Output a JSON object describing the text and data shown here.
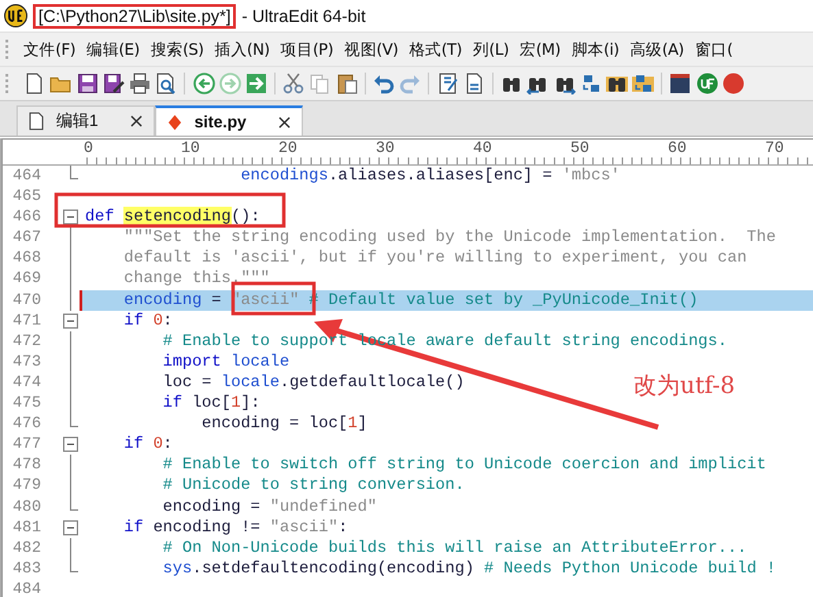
{
  "window": {
    "title_path": "[C:\\Python27\\Lib\\site.py*]",
    "title_app": "- UltraEdit 64-bit"
  },
  "menu": [
    "文件(F)",
    "编辑(E)",
    "搜索(S)",
    "插入(N)",
    "项目(P)",
    "视图(V)",
    "格式(T)",
    "列(L)",
    "宏(M)",
    "脚本(i)",
    "高级(A)",
    "窗口("
  ],
  "tabs": [
    {
      "label": "编辑1",
      "kind": "blank",
      "selected": false
    },
    {
      "label": "site.py",
      "kind": "source",
      "selected": true
    }
  ],
  "ruler": {
    "labels": [
      "0",
      "10",
      "20",
      "30",
      "40",
      "50",
      "60",
      "70"
    ]
  },
  "lines": [
    {
      "number": "464",
      "kind": "end",
      "highlighted": false,
      "tokens": [
        {
          "kind": "mod",
          "text": "                encodings"
        },
        {
          "kind": "plain",
          "text": ".aliases.aliases[enc] = "
        },
        {
          "kind": "str",
          "text": "'mbcs'"
        }
      ]
    },
    {
      "number": "465",
      "kind": "plain",
      "highlighted": false
    },
    {
      "number": "466",
      "kind": "start",
      "highlighted": false,
      "tokens": [
        {
          "kind": "kw",
          "text": "def "
        },
        {
          "kind": "hl",
          "text": "setencoding"
        },
        {
          "kind": "plain",
          "text": "():"
        }
      ]
    },
    {
      "number": "467",
      "kind": "body",
      "highlighted": false,
      "tokens": [
        {
          "kind": "str",
          "text": "    \"\"\"Set the string encoding used by the Unicode implementation.  The"
        }
      ]
    },
    {
      "number": "468",
      "kind": "body",
      "highlighted": false,
      "tokens": [
        {
          "kind": "str",
          "text": "    default is 'ascii', but if you're willing to experiment, you can"
        }
      ]
    },
    {
      "number": "469",
      "kind": "body",
      "highlighted": false,
      "tokens": [
        {
          "kind": "str",
          "text": "    change this.\"\"\""
        }
      ]
    },
    {
      "number": "470",
      "kind": "body",
      "highlighted": true,
      "tokens": [
        {
          "kind": "mod",
          "text": "    encoding"
        },
        {
          "kind": "plain",
          "text": " = "
        },
        {
          "kind": "str",
          "text": "\"ascii\""
        },
        {
          "kind": "com",
          "text": " # Default value set by _PyUnicode_Init()"
        }
      ]
    },
    {
      "number": "471",
      "kind": "start",
      "highlighted": false,
      "tokens": [
        {
          "kind": "kw",
          "text": "    if "
        },
        {
          "kind": "num",
          "text": "0"
        },
        {
          "kind": "plain",
          "text": ":"
        }
      ]
    },
    {
      "number": "472",
      "kind": "body",
      "highlighted": false,
      "tokens": [
        {
          "kind": "com",
          "text": "        # Enable to support locale aware default string encodings."
        }
      ]
    },
    {
      "number": "473",
      "kind": "body",
      "highlighted": false,
      "tokens": [
        {
          "kind": "kw",
          "text": "        import "
        },
        {
          "kind": "mod",
          "text": "locale"
        }
      ]
    },
    {
      "number": "474",
      "kind": "body",
      "highlighted": false,
      "tokens": [
        {
          "kind": "plain",
          "text": "        loc = "
        },
        {
          "kind": "mod",
          "text": "locale"
        },
        {
          "kind": "plain",
          "text": ".getdefaultlocale()"
        }
      ]
    },
    {
      "number": "475",
      "kind": "body",
      "highlighted": false,
      "tokens": [
        {
          "kind": "kw",
          "text": "        if"
        },
        {
          "kind": "plain",
          "text": " loc["
        },
        {
          "kind": "num",
          "text": "1"
        },
        {
          "kind": "plain",
          "text": "]:"
        }
      ]
    },
    {
      "number": "476",
      "kind": "end",
      "highlighted": false,
      "tokens": [
        {
          "kind": "plain",
          "text": "            encoding = loc["
        },
        {
          "kind": "num",
          "text": "1"
        },
        {
          "kind": "plain",
          "text": "]"
        }
      ]
    },
    {
      "number": "477",
      "kind": "start",
      "highlighted": false,
      "tokens": [
        {
          "kind": "kw",
          "text": "    if "
        },
        {
          "kind": "num",
          "text": "0"
        },
        {
          "kind": "plain",
          "text": ":"
        }
      ]
    },
    {
      "number": "478",
      "kind": "body",
      "highlighted": false,
      "tokens": [
        {
          "kind": "com",
          "text": "        # Enable to switch off string to Unicode coercion and implicit"
        }
      ]
    },
    {
      "number": "479",
      "kind": "body",
      "highlighted": false,
      "tokens": [
        {
          "kind": "com",
          "text": "        # Unicode to string conversion."
        }
      ]
    },
    {
      "number": "480",
      "kind": "end",
      "highlighted": false,
      "tokens": [
        {
          "kind": "plain",
          "text": "        encoding = "
        },
        {
          "kind": "str",
          "text": "\"undefined\""
        }
      ]
    },
    {
      "number": "481",
      "kind": "start",
      "highlighted": false,
      "tokens": [
        {
          "kind": "kw",
          "text": "    if"
        },
        {
          "kind": "plain",
          "text": " encoding != "
        },
        {
          "kind": "str",
          "text": "\"ascii\""
        },
        {
          "kind": "plain",
          "text": ":"
        }
      ]
    },
    {
      "number": "482",
      "kind": "body",
      "highlighted": false,
      "tokens": [
        {
          "kind": "com",
          "text": "        # On Non-Unicode builds this will raise an AttributeError..."
        }
      ]
    },
    {
      "number": "483",
      "kind": "end",
      "highlighted": false,
      "tokens": [
        {
          "kind": "mod",
          "text": "        sys"
        },
        {
          "kind": "plain",
          "text": ".setdefaultencoding(encoding) "
        },
        {
          "kind": "com",
          "text": "# Needs Python Unicode build !"
        }
      ]
    },
    {
      "number": "484",
      "kind": "plain",
      "highlighted": false
    }
  ],
  "annotation": {
    "text": "改为utf-8"
  }
}
